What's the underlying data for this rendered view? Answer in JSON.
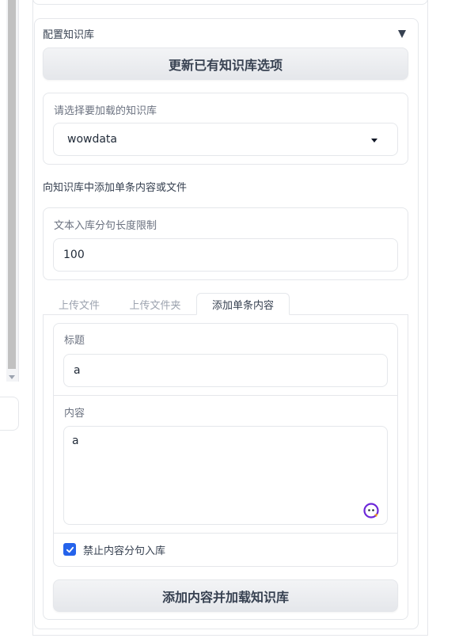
{
  "accordion": {
    "title": "配置知识库",
    "update_button": "更新已有知识库选项"
  },
  "kb_select": {
    "label": "请选择要加载的知识库",
    "value": "wowdata"
  },
  "add_section": {
    "label": "向知识库中添加单条内容或文件"
  },
  "sentence_limit": {
    "label": "文本入库分句长度限制",
    "value": "100"
  },
  "tabs": [
    {
      "label": "上传文件",
      "active": false
    },
    {
      "label": "上传文件夹",
      "active": false
    },
    {
      "label": "添加单条内容",
      "active": true
    }
  ],
  "single_content": {
    "title_label": "标题",
    "title_value": "a",
    "content_label": "内容",
    "content_value": "a",
    "no_split_label": "禁止内容分句入库",
    "no_split_checked": true,
    "submit_button": "添加内容并加载知识库"
  },
  "colors": {
    "accent": "#2563eb",
    "border": "#e5e7eb"
  }
}
